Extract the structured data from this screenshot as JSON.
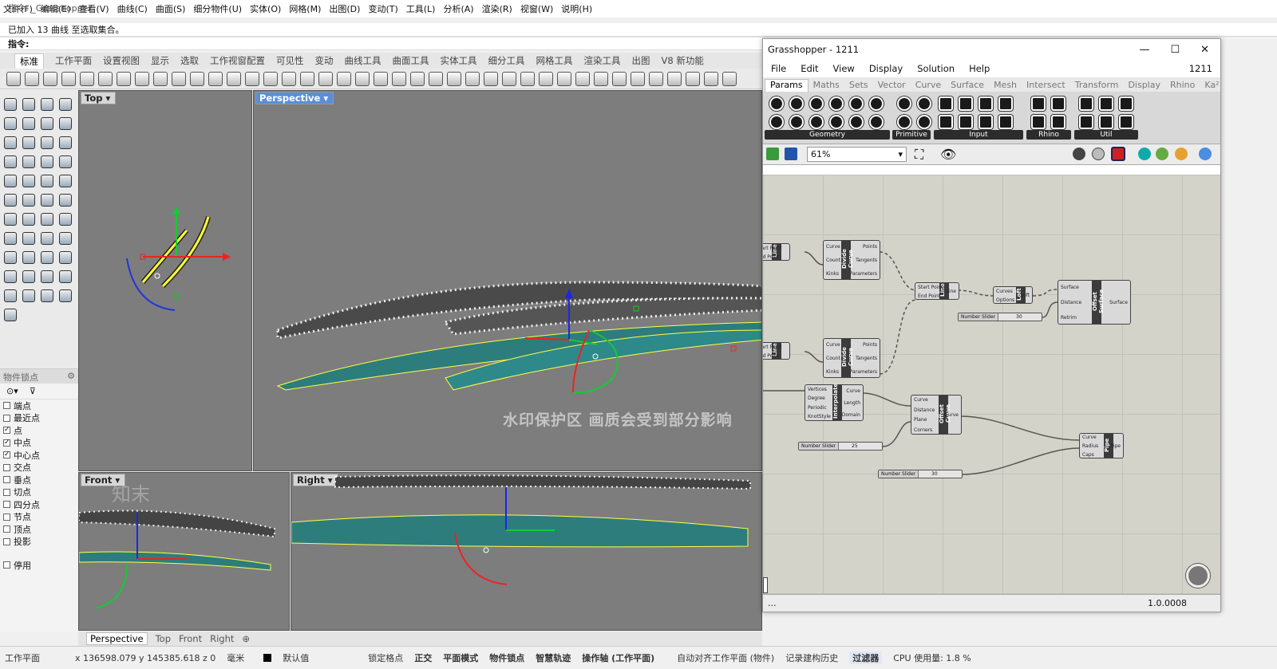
{
  "menu": [
    "文件(F)",
    "编辑(E)",
    "查看(V)",
    "曲线(C)",
    "曲面(S)",
    "细分物件(U)",
    "实体(O)",
    "网格(M)",
    "出图(D)",
    "变动(T)",
    "工具(L)",
    "分析(A)",
    "渲染(R)",
    "视窗(W)",
    "说明(H)"
  ],
  "command": {
    "history1": "指令: _Grasshopper",
    "history2": "已加入 13 曲线 至选取集合。",
    "prompt": "指令:"
  },
  "ribbon_tabs": [
    "标准",
    "工作平面",
    "设置视图",
    "显示",
    "选取",
    "工作视窗配置",
    "可见性",
    "变动",
    "曲线工具",
    "曲面工具",
    "实体工具",
    "细分工具",
    "网格工具",
    "渲染工具",
    "出图",
    "V8 新功能"
  ],
  "viewports": {
    "top": "Top",
    "perspective": "Perspective",
    "front": "Front",
    "right": "Right"
  },
  "viewport_tabs": [
    "Perspective",
    "Top",
    "Front",
    "Right"
  ],
  "osnap": {
    "title": "物件锁点",
    "items": [
      {
        "label": "端点",
        "checked": false
      },
      {
        "label": "最近点",
        "checked": false
      },
      {
        "label": "点",
        "checked": true
      },
      {
        "label": "中点",
        "checked": true
      },
      {
        "label": "中心点",
        "checked": true
      },
      {
        "label": "交点",
        "checked": false
      },
      {
        "label": "垂点",
        "checked": false
      },
      {
        "label": "切点",
        "checked": false
      },
      {
        "label": "四分点",
        "checked": false
      },
      {
        "label": "节点",
        "checked": false
      },
      {
        "label": "顶点",
        "checked": false
      },
      {
        "label": "投影",
        "checked": false
      }
    ],
    "disable": "停用"
  },
  "watermark": "水印保护区 画质会受到部分影响",
  "watermark_brand": "知末",
  "status": {
    "plane": "工作平面",
    "coords": "x 136598.079  y 145385.618  z 0",
    "unit": "毫米",
    "layer": "默认值",
    "items": [
      "锁定格点",
      "正交",
      "平面模式",
      "物件锁点",
      "智慧轨迹",
      "操作轴 (工作平面)"
    ],
    "autoalign": "自动对齐工作平面 (物件)",
    "history": "记录建构历史",
    "filter": "过滤器",
    "cpu": "CPU 使用量: 1.8 %"
  },
  "grasshopper": {
    "title": "Grasshopper - 1211",
    "menu": [
      "File",
      "Edit",
      "View",
      "Display",
      "Solution",
      "Help"
    ],
    "doc": "1211",
    "tabs": [
      "Params",
      "Maths",
      "Sets",
      "Vector",
      "Curve",
      "Surface",
      "Mesh",
      "Intersect",
      "Transform",
      "Display",
      "Rhino",
      "Ka²"
    ],
    "groups": [
      "Geometry",
      "Primitive",
      "Input",
      "Rhino",
      "Util"
    ],
    "zoom": "61%",
    "footer_left": "...",
    "footer_version": "1.0.0008",
    "components": {
      "line1": {
        "inputs": [
          "Start Point",
          "End Point"
        ],
        "name": "Line"
      },
      "line2": {
        "inputs": [
          "Start Point",
          "End Point"
        ],
        "name": "Line"
      },
      "divide1": {
        "inputs": [
          "Curve",
          "Count",
          "Kinks"
        ],
        "name": "Divide Curve",
        "outputs": [
          "Points",
          "Tangents",
          "Parameters"
        ]
      },
      "divide2": {
        "inputs": [
          "Curve",
          "Count",
          "Kinks"
        ],
        "name": "Divide Curve",
        "outputs": [
          "Points",
          "Tangents",
          "Parameters"
        ]
      },
      "line3": {
        "inputs": [
          "Start Point",
          "End Point"
        ],
        "name": "Line",
        "outputs": [
          "Line"
        ]
      },
      "loft": {
        "inputs": [
          "Curves",
          "Options"
        ],
        "name": "Loft",
        "outputs": [
          "Loft"
        ]
      },
      "offset_surface": {
        "inputs": [
          "Surface",
          "Distance",
          "Retrim"
        ],
        "name": "Offset Surface",
        "outputs": [
          "Surface"
        ]
      },
      "interpolate": {
        "inputs": [
          "Vertices",
          "Degree",
          "Periodic",
          "KnotStyle"
        ],
        "name": "Interpolate",
        "outputs": [
          "Curve",
          "Length",
          "Domain"
        ]
      },
      "offset_curve": {
        "inputs": [
          "Curve",
          "Distance",
          "Plane",
          "Corners"
        ],
        "name": "Offset Curve",
        "outputs": [
          "Curve"
        ]
      },
      "pipe": {
        "inputs": [
          "Curve",
          "Radius",
          "Caps"
        ],
        "name": "Pipe",
        "outputs": [
          "Pipe"
        ]
      }
    },
    "sliders": [
      {
        "label": "Number Slider",
        "value": "30"
      },
      {
        "label": "Number Slider",
        "value": "25"
      },
      {
        "label": "Number Slider",
        "value": "30"
      }
    ]
  }
}
